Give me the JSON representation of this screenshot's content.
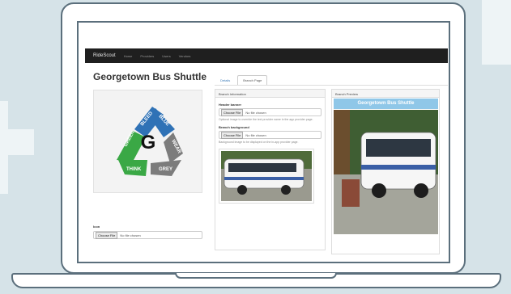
{
  "app": {
    "brand": "RideScout",
    "nav_links": [
      "Home",
      "Providers",
      "Users",
      "Vendors"
    ]
  },
  "page": {
    "title": "Georgetown Bus Shuttle",
    "tabs": [
      {
        "label": "Details",
        "active": false
      },
      {
        "label": "Branch Page",
        "active": true
      }
    ]
  },
  "logo": {
    "center_letter": "G",
    "segments": [
      "GREEN",
      "BLEED",
      "BLUE",
      "WEAR",
      "GREY",
      "THINK"
    ],
    "colors": {
      "green": "#3aa845",
      "blue": "#2f72b6",
      "grey": "#7c7c7c"
    }
  },
  "icon_field": {
    "label": "Icon",
    "button": "Choose File",
    "value": "No file chosen"
  },
  "branch_panel": {
    "heading": "Branch Information",
    "header_banner": {
      "label": "Header banner",
      "button": "Choose File",
      "value": "No file chosen",
      "help": "Optional image to override the text provider name in the app provider page."
    },
    "branch_background": {
      "label": "Branch background",
      "button": "Choose File",
      "value": "No file chosen",
      "help": "Background image to be displayed on the in-app provider page."
    }
  },
  "preview_panel": {
    "heading": "Branch Preview",
    "banner_title": "Georgetown Bus Shuttle"
  },
  "colors": {
    "navbar": "#1f1f1f",
    "link": "#3a7ab8",
    "preview_banner": "#8fc7e8"
  }
}
